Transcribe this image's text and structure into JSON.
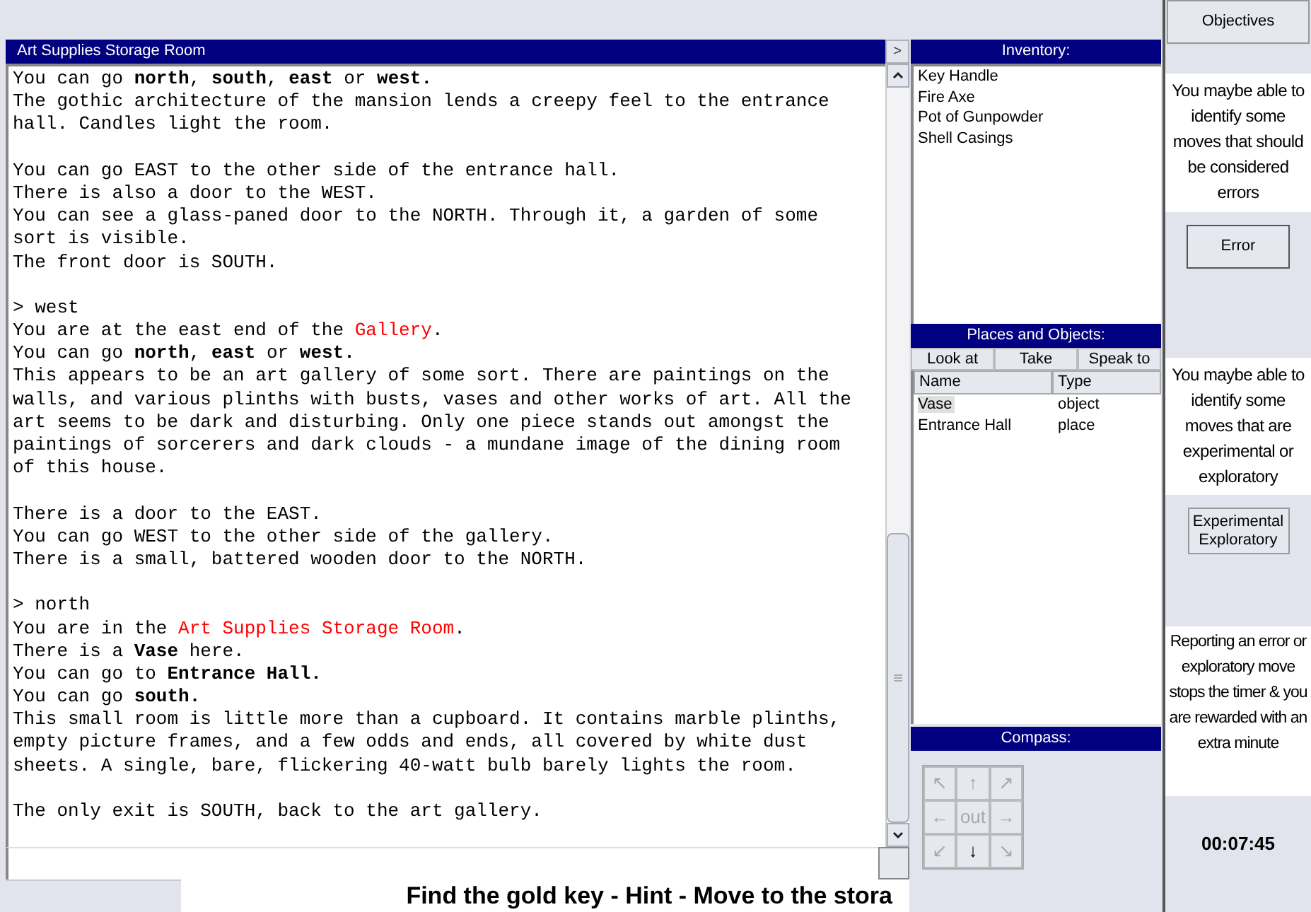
{
  "log_panel": {
    "title": "Art Supplies Storage Room",
    "toggle": ">",
    "paragraphs": [
      [
        [
          {
            "kind": "text",
            "text": "You can go **north**, **south**, **east** or **west.**"
          }
        ],
        [
          {
            "kind": "text",
            "text": "The gothic architecture of the mansion lends a creepy feel to the entrance"
          }
        ],
        [
          {
            "kind": "text",
            "text": "hall. Candles light the room."
          }
        ]
      ],
      [
        [
          {
            "kind": "text",
            "text": "You can go EAST to the other side of the entrance hall."
          }
        ],
        [
          {
            "kind": "text",
            "text": "There is also a door to the WEST."
          }
        ],
        [
          {
            "kind": "text",
            "text": "You can see a glass-paned door to the NORTH. Through it, a garden of some"
          }
        ],
        [
          {
            "kind": "text",
            "text": "sort is visible."
          }
        ],
        [
          {
            "kind": "text",
            "text": "The front door is SOUTH."
          }
        ]
      ],
      [
        [
          {
            "kind": "text",
            "text": "> west"
          }
        ],
        [
          {
            "kind": "text",
            "text": "You are at the east end of the "
          },
          {
            "kind": "place",
            "text": "Gallery"
          },
          {
            "kind": "text",
            "text": "."
          }
        ],
        [
          {
            "kind": "text",
            "text": "You can go **north**, **east** or **west.**"
          }
        ],
        [
          {
            "kind": "text",
            "text": "This appears to be an art gallery of some sort. There are paintings on the"
          }
        ],
        [
          {
            "kind": "text",
            "text": "walls, and various plinths with busts, vases and other works of art. All the"
          }
        ],
        [
          {
            "kind": "text",
            "text": "art seems to be dark and disturbing. Only one piece stands out amongst the"
          }
        ],
        [
          {
            "kind": "text",
            "text": "paintings of sorcerers and dark clouds - a mundane image of the dining room"
          }
        ],
        [
          {
            "kind": "text",
            "text": "of this house."
          }
        ]
      ],
      [
        [
          {
            "kind": "text",
            "text": "There is a door to the EAST."
          }
        ],
        [
          {
            "kind": "text",
            "text": "You can go WEST to the other side of the gallery."
          }
        ],
        [
          {
            "kind": "text",
            "text": "There is a small, battered wooden door to the NORTH."
          }
        ]
      ],
      [
        [
          {
            "kind": "text",
            "text": "> north"
          }
        ],
        [
          {
            "kind": "text",
            "text": "You are in the "
          },
          {
            "kind": "place",
            "text": "Art Supplies Storage Room"
          },
          {
            "kind": "text",
            "text": "."
          }
        ],
        [
          {
            "kind": "text",
            "text": "There is a **Vase** here."
          }
        ],
        [
          {
            "kind": "text",
            "text": "You can go to **Entrance Hall.**"
          }
        ],
        [
          {
            "kind": "text",
            "text": "You can go **south.**"
          }
        ],
        [
          {
            "kind": "text",
            "text": "This small room is little more than a cupboard. It contains marble plinths,"
          }
        ],
        [
          {
            "kind": "text",
            "text": "empty picture frames, and a few odds and ends, all covered by white dust"
          }
        ],
        [
          {
            "kind": "text",
            "text": "sheets. A single, bare, flickering 40-watt bulb barely lights the room."
          }
        ]
      ],
      [
        [
          {
            "kind": "text",
            "text": "The only exit is SOUTH, back to the art gallery."
          }
        ]
      ]
    ]
  },
  "inventory": {
    "title": "Inventory:",
    "items": [
      "Key Handle",
      "Fire Axe",
      "Pot of Gunpowder",
      "Shell Casings"
    ]
  },
  "places": {
    "title": "Places and Objects:",
    "actions": [
      "Look at",
      "Take",
      "Speak to"
    ],
    "columns": [
      "Name",
      "Type"
    ],
    "rows": [
      {
        "name": "Vase",
        "type": "object",
        "selected": true
      },
      {
        "name": "Entrance Hall",
        "type": "place",
        "selected": false
      }
    ]
  },
  "compass": {
    "title": "Compass:",
    "buttons": [
      {
        "label": "↖",
        "disabled": true
      },
      {
        "label": "↑",
        "disabled": true
      },
      {
        "label": "↗",
        "disabled": true
      },
      {
        "label": "←",
        "disabled": true
      },
      {
        "label": "out",
        "disabled": true
      },
      {
        "label": "→",
        "disabled": true
      },
      {
        "label": "↙",
        "disabled": true
      },
      {
        "label": "↓",
        "disabled": false
      },
      {
        "label": "↘",
        "disabled": true
      }
    ]
  },
  "side": {
    "objectives_button": "Objectives",
    "error_note": "You maybe able to identify some moves that should be considered errors",
    "error_button": "Error",
    "explore_note": "You maybe able to identify some moves that are experimental or exploratory",
    "explore_button": [
      "Experimental",
      "Exploratory"
    ],
    "timer_note": "Reporting an error or exploratory move stops the timer & you are rewarded with an extra minute",
    "timer": "00:07:45"
  },
  "hint": "Find the gold key - Hint - Move to the stora"
}
